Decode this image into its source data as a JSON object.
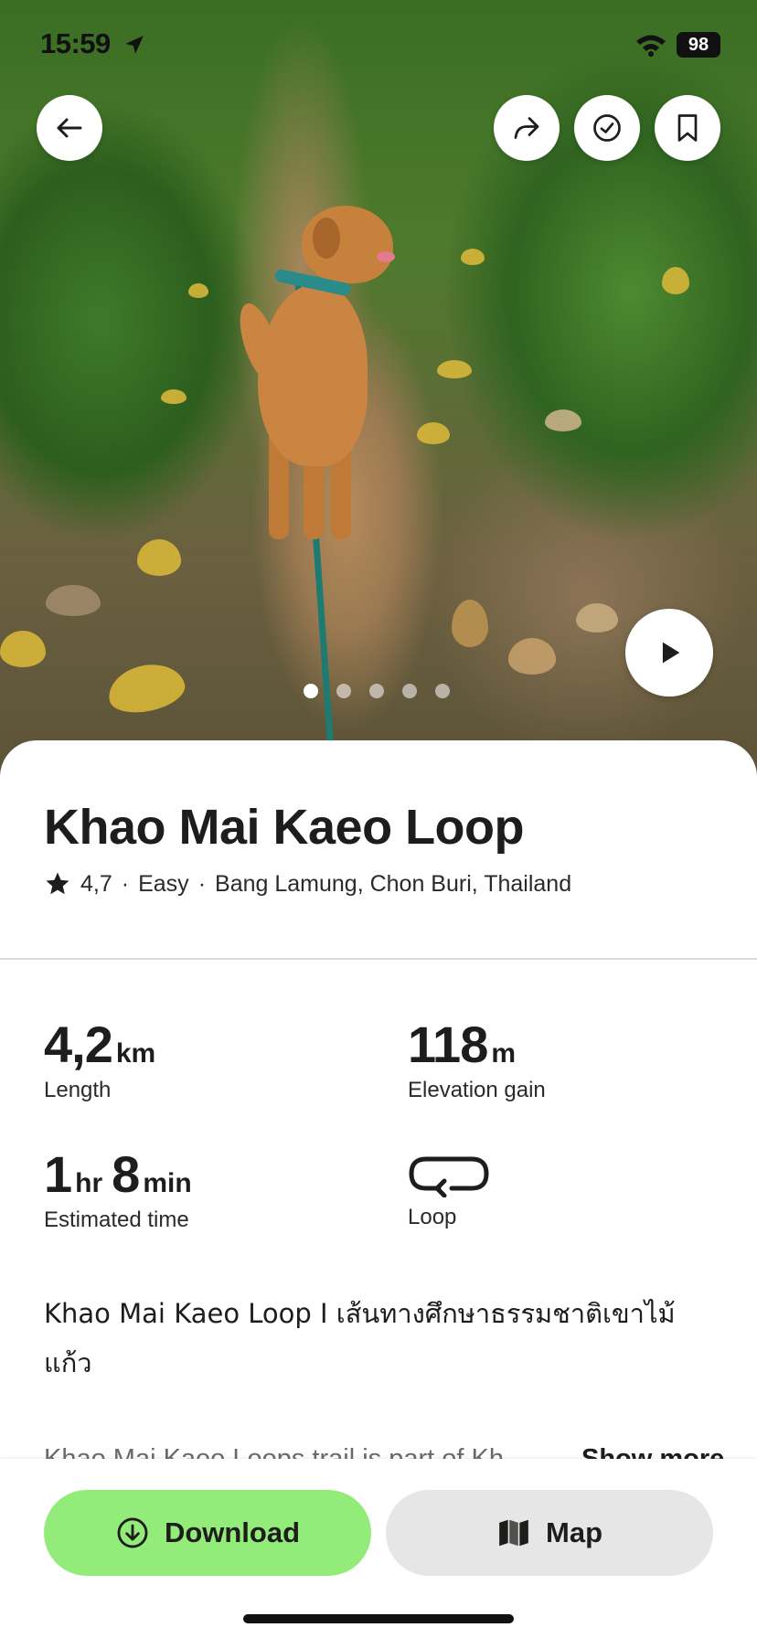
{
  "status_bar": {
    "time": "15:59",
    "battery": "98"
  },
  "hero": {
    "carousel_count": 5,
    "carousel_active": 0
  },
  "trail": {
    "title": "Khao Mai Kaeo Loop",
    "rating": "4,7",
    "difficulty": "Easy",
    "location": "Bang Lamung, Chon Buri, Thailand"
  },
  "stats": {
    "length": {
      "value": "4,2",
      "unit": "km",
      "label": "Length"
    },
    "elevation": {
      "value": "118",
      "unit": "m",
      "label": "Elevation gain"
    },
    "time": {
      "hours": "1",
      "hours_unit": "hr",
      "minutes": "8",
      "minutes_unit": "min",
      "label": "Estimated time"
    },
    "route_type": {
      "label": "Loop",
      "icon": "loop-icon"
    }
  },
  "description": {
    "heading": "Khao Mai Kaeo Loop I เส้นทางศึกษาธรรมชาติเขาไม้แก้ว",
    "preview": "Khao Mai Kaeo Loops trail is part of Kh",
    "show_more": "Show more"
  },
  "actions": {
    "download": "Download",
    "map": "Map"
  },
  "colors": {
    "download_bg": "#93ec7a",
    "map_bg": "#e6e6e6",
    "text": "#1d1d1b"
  }
}
